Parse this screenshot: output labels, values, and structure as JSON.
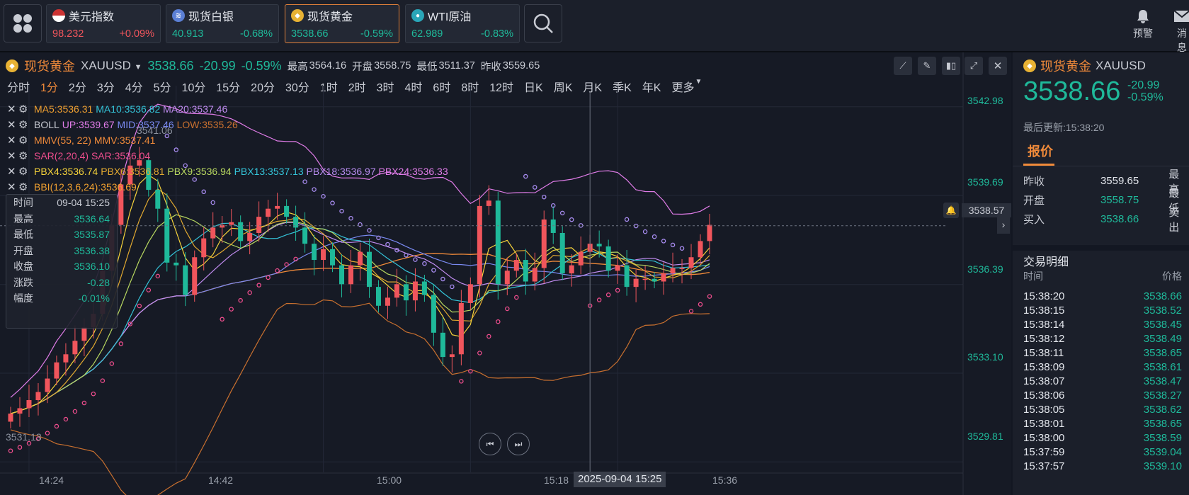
{
  "top_cards": [
    {
      "name": "美元指数",
      "price": "98.232",
      "change": "+0.09%",
      "flag": "us-flag-icon",
      "dir": "up"
    },
    {
      "name": "现货白银",
      "price": "40.913",
      "change": "-0.68%",
      "flag": "silver-icon",
      "dir": "down"
    },
    {
      "name": "现货黄金",
      "price": "3538.66",
      "change": "-0.59%",
      "flag": "gold-icon",
      "dir": "down"
    },
    {
      "name": "WTI原油",
      "price": "62.989",
      "change": "-0.83%",
      "flag": "oil-icon",
      "dir": "down"
    }
  ],
  "top_right": {
    "alert": "预警",
    "message": "消息"
  },
  "quote": {
    "name": "现货黄金",
    "code": "XAUUSD",
    "price": "3538.66",
    "change": "-20.99",
    "pct": "-0.59%",
    "high_label": "最高",
    "high": "3564.16",
    "open_label": "开盘",
    "open": "3558.75",
    "low_label": "最低",
    "low": "3511.37",
    "prev_label": "昨收",
    "prev": "3559.65"
  },
  "periods": [
    "分时",
    "1分",
    "2分",
    "3分",
    "4分",
    "5分",
    "10分",
    "15分",
    "20分",
    "30分",
    "1时",
    "2时",
    "3时",
    "4时",
    "6时",
    "8时",
    "12时",
    "日K",
    "周K",
    "月K",
    "季K",
    "年K",
    "更多"
  ],
  "selected_period": "1分",
  "indicators": {
    "ma": {
      "ma5": "MA5:3536.31",
      "ma10": "MA10:3536.82",
      "ma20": "MA20:3537.46"
    },
    "boll": {
      "name": "BOLL",
      "up": "UP:3539.67",
      "mid": "MID:3537.46",
      "low": "LOW:3535.26"
    },
    "mmv": {
      "name": "MMV(55, 22)",
      "val": "MMV:3537.41"
    },
    "sar": {
      "name": "SAR(2,20,4)",
      "val": "SAR:3536.04"
    },
    "pbx": {
      "p4": "PBX4:3536.74",
      "p6": "PBX6:3536.81",
      "p9": "PBX9:3536.94",
      "p13": "PBX13:3537.13",
      "p18": "PBX18:3536.97",
      "p24": "PBX24:3536.33"
    },
    "bbi": {
      "name": "BBI(12,3,6,24)",
      "val": "BBI(12,3,6,24):3536.69"
    }
  },
  "tooltip": {
    "time_label": "时间",
    "time": "09-04 15:25",
    "high_label": "最高",
    "high": "3536.64",
    "low_label": "最低",
    "low": "3535.87",
    "open_label": "开盘",
    "open": "3536.38",
    "close_label": "收盘",
    "close": "3536.10",
    "chg_label": "涨跌",
    "chg": "-0.28",
    "amp_label": "幅度",
    "amp": "-0.01%"
  },
  "y_axis": [
    "3542.98",
    "3539.69",
    "3536.39",
    "3533.10",
    "3529.81"
  ],
  "current_price_tag": "3538.57",
  "x_axis": [
    "14:24",
    "14:42",
    "15:00",
    "15:18",
    "15:36"
  ],
  "crosshair_time": "2025-09-04 15:25",
  "chart_annotations": {
    "low_mark": "3531.13",
    "high_mark": "3541.06"
  },
  "chart_data": {
    "type": "candlestick",
    "unit": "USD",
    "x": [
      "14:22",
      "14:23",
      "14:24",
      "14:25",
      "14:26",
      "14:27",
      "14:28",
      "14:29",
      "14:30",
      "14:31",
      "14:32",
      "14:33",
      "14:34",
      "14:35",
      "14:36",
      "14:37",
      "14:38",
      "14:39",
      "14:40",
      "14:41",
      "14:42",
      "14:43",
      "14:44",
      "14:45",
      "14:46",
      "14:47",
      "14:48",
      "14:49",
      "14:50",
      "14:51",
      "14:52",
      "14:53",
      "14:54",
      "14:55",
      "14:56",
      "14:57",
      "14:58",
      "14:59",
      "15:00",
      "15:01",
      "15:02",
      "15:03",
      "15:04",
      "15:05",
      "15:06",
      "15:07",
      "15:08",
      "15:09",
      "15:10",
      "15:11",
      "15:12",
      "15:13",
      "15:14",
      "15:15",
      "15:16",
      "15:17",
      "15:18",
      "15:19",
      "15:20",
      "15:21",
      "15:22",
      "15:23",
      "15:24",
      "15:25",
      "15:26",
      "15:27",
      "15:28",
      "15:29",
      "15:30",
      "15:31",
      "15:32",
      "15:33",
      "15:34",
      "15:35",
      "15:36",
      "15:37",
      "15:38"
    ],
    "close": [
      3531.6,
      3531.8,
      3532.1,
      3532.4,
      3532.9,
      3533.5,
      3533.8,
      3534.3,
      3534.8,
      3535.3,
      3536.9,
      3538.6,
      3540.1,
      3540.8,
      3541.0,
      3539.9,
      3539.2,
      3537.2,
      3537.1,
      3536.0,
      3537.4,
      3538.1,
      3538.5,
      3538.6,
      3538.7,
      3538.0,
      3538.3,
      3538.9,
      3539.2,
      3539.3,
      3538.9,
      3538.5,
      3537.9,
      3537.3,
      3537.7,
      3537.1,
      3536.4,
      3537.1,
      3537.6,
      3536.3,
      3535.6,
      3535.9,
      3536.4,
      3535.8,
      3536.5,
      3536.0,
      3534.6,
      3533.7,
      3533.8,
      3535.7,
      3536.4,
      3539.3,
      3539.5,
      3536.4,
      3536.9,
      3537.3,
      3536.5,
      3537.0,
      3538.8,
      3538.3,
      3536.8,
      3537.1,
      3537.6,
      3537.9,
      3537.8,
      3536.9,
      3537.1,
      3536.3,
      3536.6,
      3536.6,
      3536.5,
      3536.8,
      3537.0,
      3537.0,
      3537.4,
      3538.0,
      3538.6
    ]
  },
  "right_panel": {
    "name": "现货黄金",
    "code": "XAUUSD",
    "price": "3538.66",
    "change": "-20.99",
    "pct": "-0.59%",
    "updated": "最后更新:15:38:20",
    "tab": "报价",
    "rows": [
      {
        "label": "昨收",
        "value": "3559.65",
        "label2": "最高"
      },
      {
        "label": "开盘",
        "value": "3558.75",
        "label2": "最低"
      },
      {
        "label": "买入",
        "value": "3538.66",
        "label2": "卖出"
      }
    ],
    "trades_title": "交易明细",
    "time_header": "时间",
    "price_header": "价格",
    "trades": [
      {
        "t": "15:38:20",
        "p": "3538.66"
      },
      {
        "t": "15:38:15",
        "p": "3538.52"
      },
      {
        "t": "15:38:14",
        "p": "3538.45"
      },
      {
        "t": "15:38:12",
        "p": "3538.49"
      },
      {
        "t": "15:38:11",
        "p": "3538.65"
      },
      {
        "t": "15:38:09",
        "p": "3538.61"
      },
      {
        "t": "15:38:07",
        "p": "3538.47"
      },
      {
        "t": "15:38:06",
        "p": "3538.27"
      },
      {
        "t": "15:38:05",
        "p": "3538.62"
      },
      {
        "t": "15:38:01",
        "p": "3538.65"
      },
      {
        "t": "15:38:00",
        "p": "3538.59"
      },
      {
        "t": "15:37:59",
        "p": "3539.04"
      },
      {
        "t": "15:37:57",
        "p": "3539.10"
      }
    ]
  },
  "colors": {
    "up": "#f0555c",
    "down": "#1fb99a",
    "accent": "#f08a3a"
  }
}
